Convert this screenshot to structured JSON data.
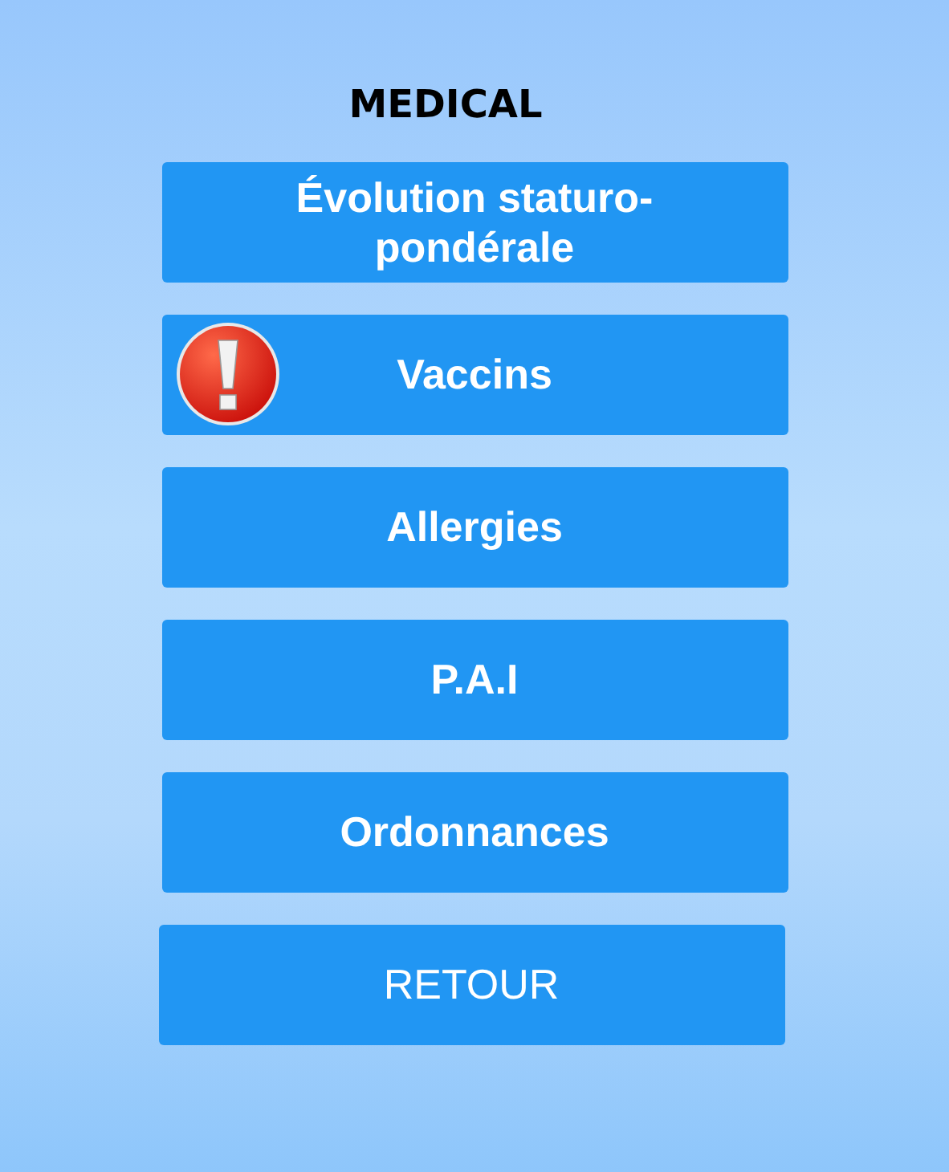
{
  "title": "MEDICAL",
  "buttons": [
    {
      "label": "Évolution staturo-pondérale",
      "kind": "menu",
      "alert": false
    },
    {
      "label": "Vaccins",
      "kind": "menu",
      "alert": true
    },
    {
      "label": "Allergies",
      "kind": "menu",
      "alert": false
    },
    {
      "label": "P.A.I",
      "kind": "menu",
      "alert": false
    },
    {
      "label": "Ordonnances",
      "kind": "menu",
      "alert": false
    },
    {
      "label": "RETOUR",
      "kind": "back",
      "alert": false
    }
  ]
}
